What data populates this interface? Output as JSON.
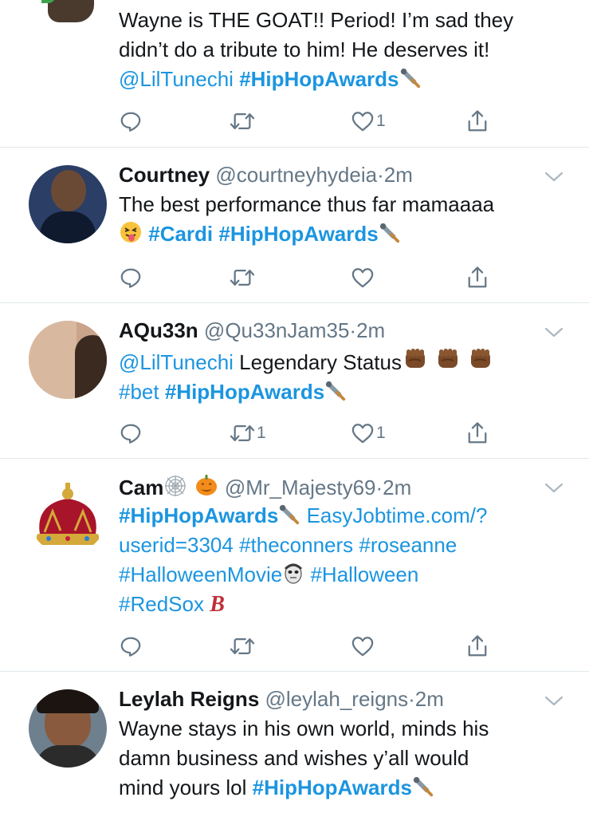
{
  "tweets": [
    {
      "name": "",
      "handle": "",
      "time": "",
      "lines": [
        "Wayne is THE GOAT!! Period! I’m sad they",
        "didn’t do a tribute to him! He deserves it!"
      ],
      "mention": "@LilTunechi",
      "hashtag": "#HipHopAwards",
      "retweets": "",
      "likes": "1"
    },
    {
      "name": "Courtney",
      "handle": "@courtneyhydeia",
      "sep": "·",
      "time": "2m",
      "line1": "The best performance thus far mamaaaa",
      "tag_cardi": "#Cardi",
      "hashtag": "#HipHopAwards",
      "retweets": "",
      "likes": ""
    },
    {
      "name": "AQu33n",
      "handle": "@Qu33nJam35",
      "sep": "·",
      "time": "2m",
      "mention": "@LilTunechi",
      "line1_text": " Legendary Status",
      "tag_bet": "#bet",
      "hashtag": "#HipHopAwards",
      "retweets": "1",
      "likes": "1"
    },
    {
      "name": "Cam",
      "handle": "@Mr_Majesty69",
      "sep": "·",
      "time": "2m",
      "hashtag": "#HipHopAwards",
      "link1": "EasyJobtime.com/?",
      "link2": "userid=3304",
      "tag_conners": "#theconners",
      "tag_roseanne": "#roseanne",
      "tag_halloweenmovie": "#HalloweenMovie",
      "tag_halloween": "#Halloween",
      "tag_redsox": "#RedSox",
      "redsox_b": "B",
      "retweets": "",
      "likes": ""
    },
    {
      "name": "Leylah Reigns",
      "handle": "@leylah_reigns",
      "sep": "·",
      "time": "2m",
      "lines": [
        "Wayne stays in his own world, minds his",
        "damn business and wishes y’all would"
      ],
      "line3": "mind yours lol ",
      "hashtag": "#HipHopAwards"
    }
  ],
  "icons": {
    "reply": "reply-icon",
    "retweet": "retweet-icon",
    "like": "heart-icon",
    "share": "share-icon",
    "chevron": "chevron-down-icon"
  },
  "colors": {
    "link": "#1b95e0",
    "secondary": "#657786",
    "divider": "#e1e8ed"
  }
}
